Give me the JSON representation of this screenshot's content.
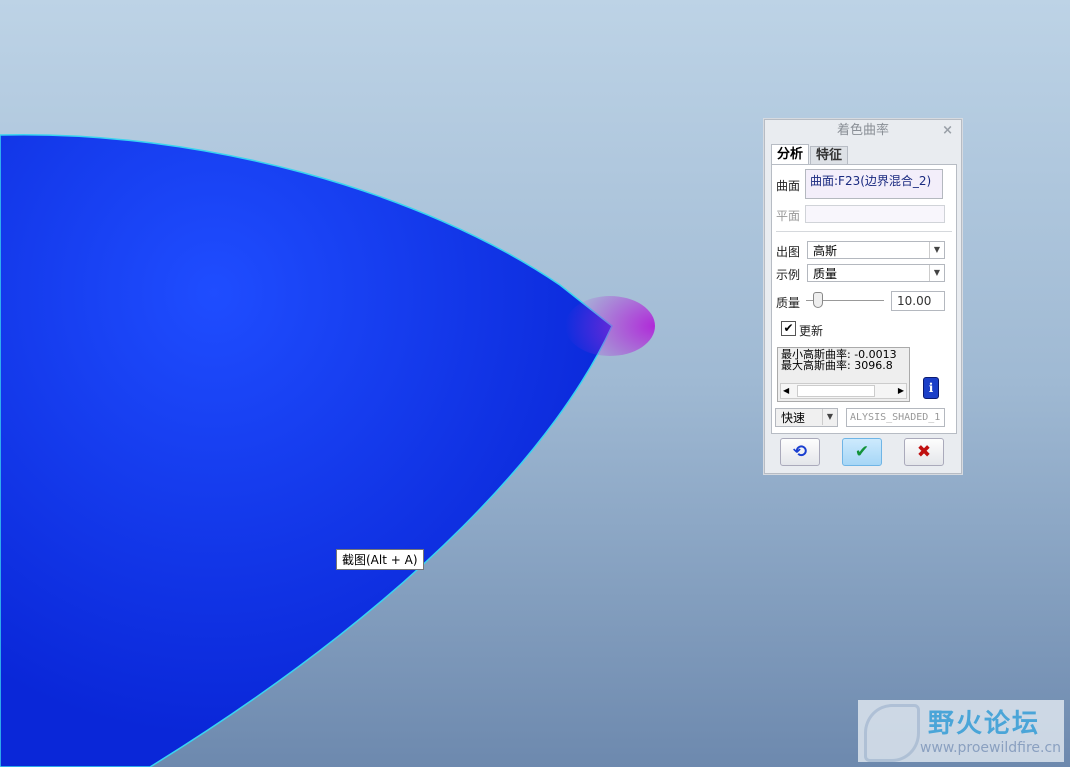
{
  "dialog": {
    "title": "着色曲率",
    "close": "×",
    "tabs": [
      {
        "label": "分析"
      },
      {
        "label": "特征"
      }
    ],
    "surface_label": "曲面",
    "surface_value": "曲面:F23(边界混合_2)",
    "plane_label": "平面",
    "output_label": "出图",
    "output_value": "高斯",
    "sample_label": "示例",
    "sample_value": "质量",
    "quality_label": "质量",
    "quality_value": "10.00",
    "quality_slider_fraction": 0.1,
    "update_label": "更新",
    "update_checked": true,
    "results": [
      "最小高斯曲率: -0.0013",
      "最大高斯曲率: 3096.8"
    ],
    "mode_value": "快速",
    "name_value": "ALYSIS_SHADED_1",
    "info": "i"
  },
  "tooltip": "截图(Alt + A)",
  "watermark": {
    "title": "野火论坛",
    "url": "www.proewildfire.cn"
  },
  "colors": {
    "surface": "#0a2fe0",
    "accent": "#1a3fd0"
  }
}
